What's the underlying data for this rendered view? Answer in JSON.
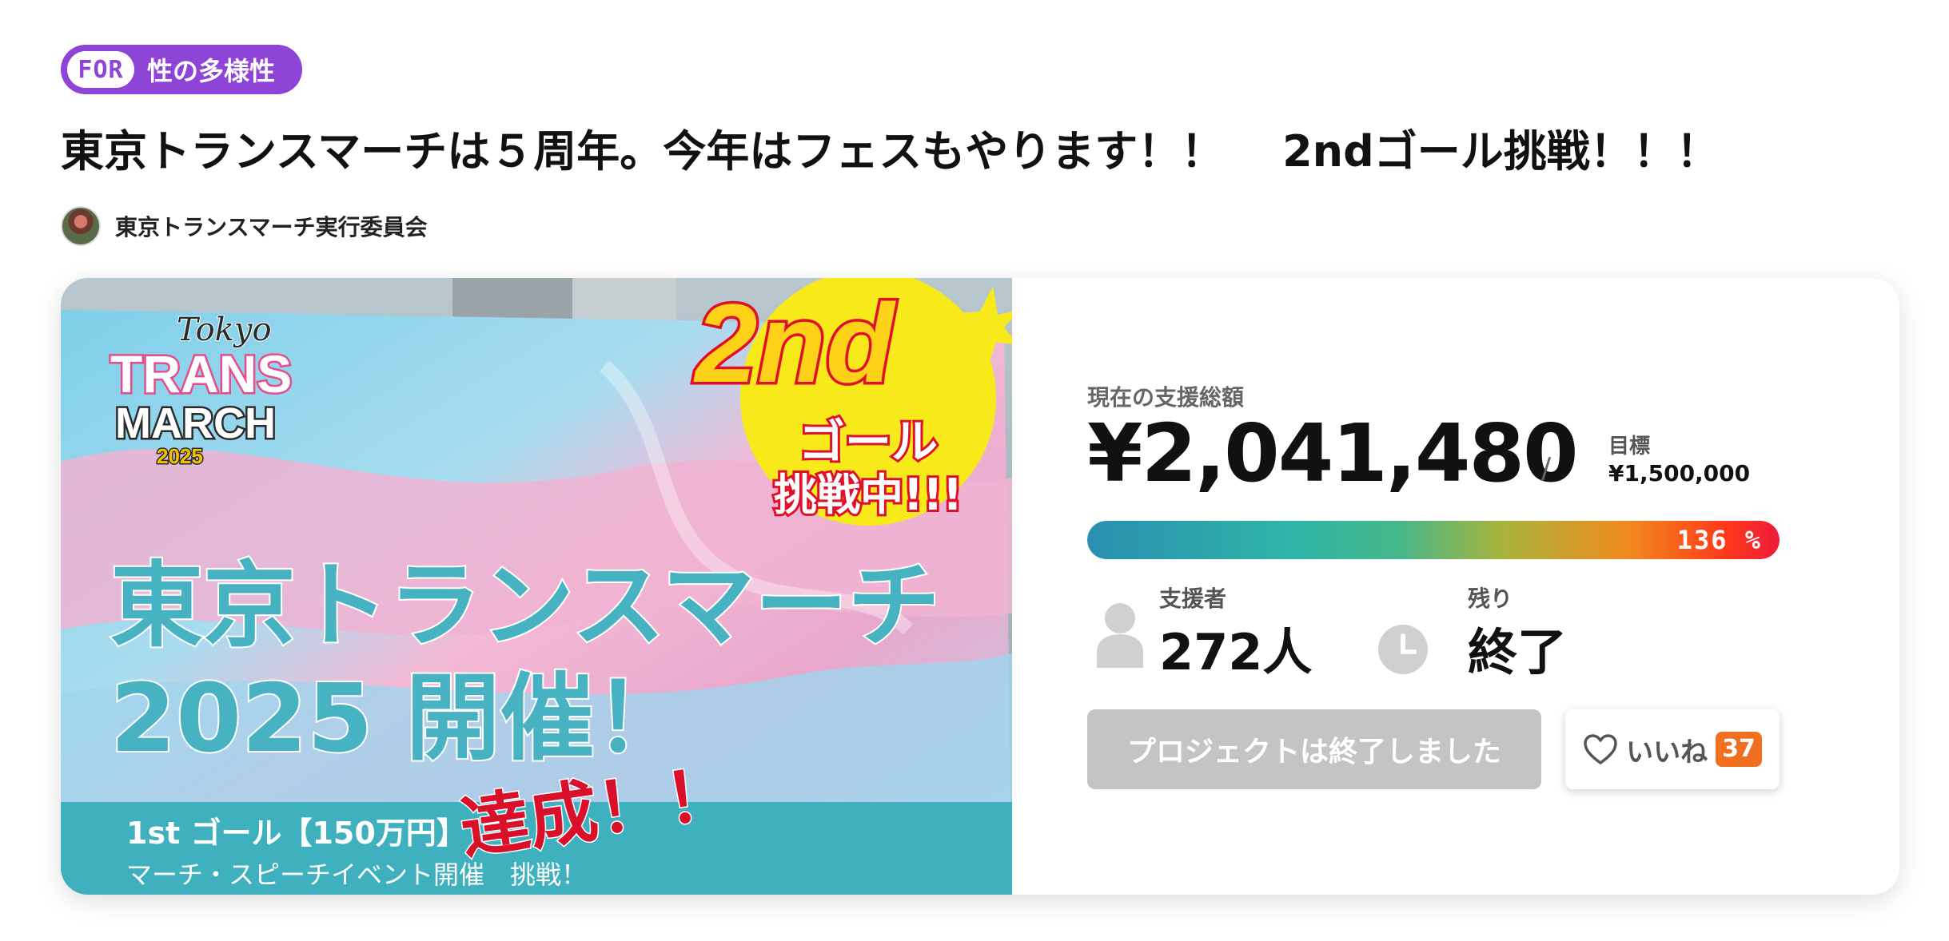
{
  "category": {
    "prefix": "FOR",
    "label": "性の多様性"
  },
  "project": {
    "title": "東京トランスマーチは５周年。今年はフェスもやります！！　 2ndゴール挑戦！！！",
    "owner_name": "東京トランスマーチ実行委員会"
  },
  "hero_image": {
    "logo_line1": "Tokyo",
    "logo_line2": "TRANS",
    "logo_line3": "MARCH",
    "logo_line4": "2025",
    "badge_line1": "2nd",
    "badge_line2": "ゴール",
    "badge_line3": "挑戦中!!!",
    "headline_line1": "東京トランスマーチ",
    "headline_line2": "2025 開催！",
    "achieved": "達成！！",
    "banner_line1": "1st ゴール【150万円】",
    "banner_line2": "マーチ・スピーチイベント開催　挑戦！"
  },
  "funding": {
    "current_label": "現在の支援総額",
    "current_amount": "¥2,041,480",
    "slash": "/",
    "goal_label": "目標",
    "goal_amount": "¥1,500,000",
    "percent_text": "136 %",
    "percent_value": 136
  },
  "stats": {
    "supporters_label": "支援者",
    "supporters_value": "272人",
    "remaining_label": "残り",
    "remaining_value": "終了"
  },
  "actions": {
    "ended_button": "プロジェクトは終了しました",
    "like_label": "いいね",
    "like_count": "37"
  },
  "icons": {
    "supporters": "person-icon",
    "remaining": "clock-icon",
    "like": "heart-icon"
  },
  "colors": {
    "category_purple": "#8e44d6",
    "like_badge_orange": "#f07020",
    "headline_teal": "#46b2c2",
    "achieved_red": "#d8102a"
  }
}
